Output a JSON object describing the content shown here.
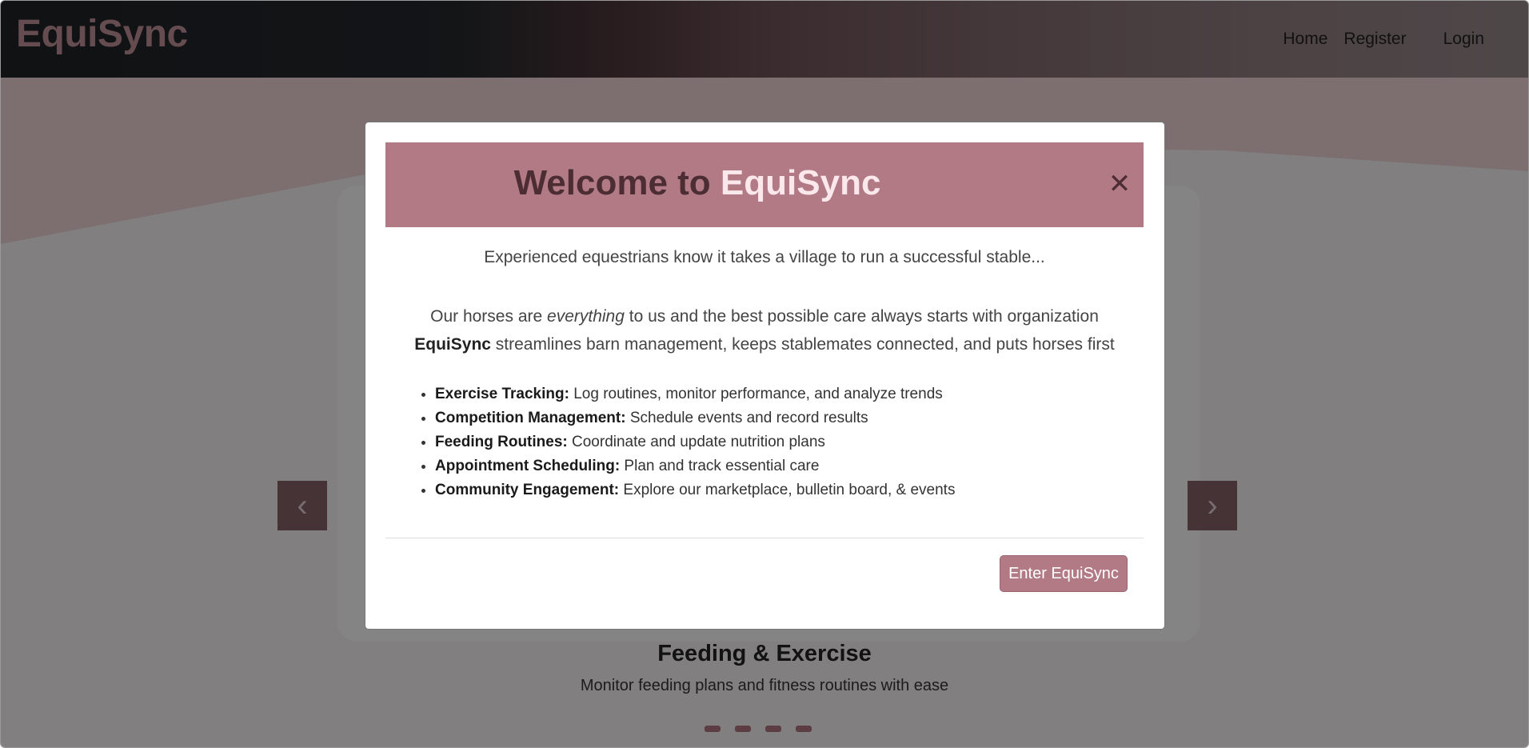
{
  "navbar": {
    "brand": "EquiSync",
    "links": [
      "Home",
      "Register",
      "Login"
    ]
  },
  "carousel": {
    "caption_title": "Feeding & Exercise",
    "caption_subtitle": "Monitor feeding plans and fitness routines with ease",
    "indicator_count": 4
  },
  "modal": {
    "title_prefix": "Welcome to ",
    "title_highlight": "EquiSync",
    "intro": "Experienced equestrians know it takes a village to run a successful stable...",
    "desc_line1_a": "Our horses are ",
    "desc_line1_em": "everything",
    "desc_line1_b": " to us and the best possible care always starts with organization",
    "desc_line2_brand": "EquiSync",
    "desc_line2_rest": " streamlines barn management, keeps stablemates connected, and puts horses first",
    "features": [
      {
        "label": "Exercise Tracking:",
        "text": " Log routines, monitor performance, and analyze trends"
      },
      {
        "label": "Competition Management:",
        "text": " Schedule events and record results"
      },
      {
        "label": "Feeding Routines:",
        "text": " Coordinate and update nutrition plans"
      },
      {
        "label": "Appointment Scheduling:",
        "text": " Plan and track essential care"
      },
      {
        "label": "Community Engagement:",
        "text": " Explore our marketplace, bulletin board, & events"
      }
    ],
    "enter_button": "Enter EquiSync"
  },
  "icons": {
    "close": "close-icon",
    "prev": "chevron-left-icon",
    "next": "chevron-right-icon"
  },
  "colors": {
    "accent": "#b17a85",
    "brand_text": "#b98a92"
  }
}
